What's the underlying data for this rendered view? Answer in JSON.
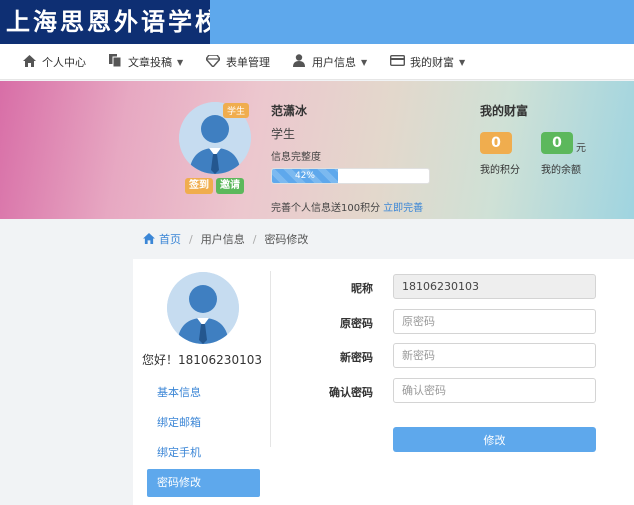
{
  "header": {
    "logo_text": "上海思恩外语学校"
  },
  "nav": {
    "items": [
      {
        "label": "个人中心",
        "icon": "home-icon",
        "has_dropdown": false
      },
      {
        "label": "文章投稿",
        "icon": "copy-icon",
        "has_dropdown": true
      },
      {
        "label": "表单管理",
        "icon": "diamond-icon",
        "has_dropdown": false
      },
      {
        "label": "用户信息",
        "icon": "user-icon",
        "has_dropdown": true
      },
      {
        "label": "我的财富",
        "icon": "credit-card-icon",
        "has_dropdown": true
      }
    ]
  },
  "profile": {
    "role_badge": "学生",
    "sign_in": "签到",
    "invite": "邀请",
    "name": "范潇冰",
    "role": "学生",
    "completion_label": "信息完整度",
    "completion_percent": 42,
    "completion_text": "42%",
    "promo_text": "完善个人信息送100积分",
    "promo_link": "立即完善"
  },
  "wealth": {
    "title": "我的财富",
    "points_value": "0",
    "points_label": "我的积分",
    "balance_value": "0",
    "balance_unit": "元",
    "balance_label": "我的余额"
  },
  "breadcrumb": {
    "home": "首页",
    "level1": "用户信息",
    "current": "密码修改"
  },
  "sidebar": {
    "greeting": "您好！18106230103",
    "items": [
      {
        "label": "基本信息",
        "active": false
      },
      {
        "label": "绑定邮箱",
        "active": false
      },
      {
        "label": "绑定手机",
        "active": false
      },
      {
        "label": "密码修改",
        "active": true
      }
    ]
  },
  "form": {
    "nickname_label": "昵称",
    "nickname_value": "18106230103",
    "old_password_label": "原密码",
    "old_password_placeholder": "原密码",
    "new_password_label": "新密码",
    "new_password_placeholder": "新密码",
    "confirm_label": "确认密码",
    "confirm_placeholder": "确认密码",
    "submit_label": "修改"
  },
  "colors": {
    "primary": "#5ea8ec",
    "logo_bg": "#0e2f73",
    "orange": "#f0ad4e",
    "green": "#5cb85c"
  }
}
